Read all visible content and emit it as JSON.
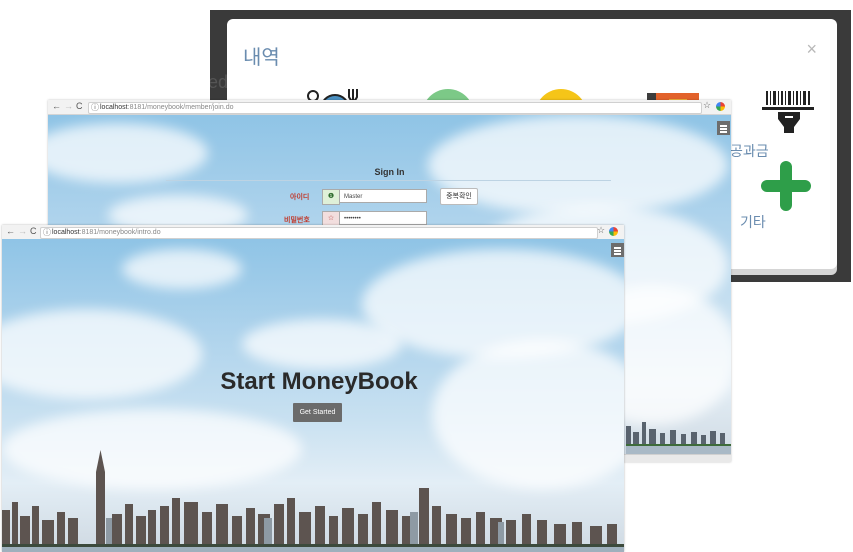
{
  "modal": {
    "background_text": "edi",
    "title": "내역",
    "close_icon": "×",
    "categories": [
      {
        "icon": "dining-icon",
        "label": ""
      },
      {
        "icon": "cash-icon",
        "label": ""
      },
      {
        "icon": "fuel-icon",
        "label": ""
      },
      {
        "icon": "book-icon",
        "label": ""
      },
      {
        "icon": "barcode-icon",
        "label": "공과금"
      },
      {
        "icon": "plus-icon",
        "label": "기타"
      }
    ],
    "colors": {
      "title": "#6a8caf",
      "plus": "#2e9e49"
    }
  },
  "join_page": {
    "browser": {
      "back": "←",
      "forward": "→",
      "reload": "C",
      "info": "ⓘ",
      "url_host": "localhost",
      "url_path": ":8181/moneybook/member/join.do",
      "star": "☆"
    },
    "title": "Sign In",
    "fields": [
      {
        "label": "아이디",
        "icon": "info-icon",
        "icon_glyph": "❶",
        "value": "Master",
        "label_color": "#c0392b",
        "icon_bg": "#dff0d8"
      },
      {
        "label": "비밀번호",
        "icon": "star-icon",
        "icon_glyph": "☆",
        "value": "••••••••",
        "label_color": "#c0392b",
        "icon_bg": "#f2dede"
      }
    ],
    "check_button": "중복확인"
  },
  "intro_page": {
    "browser": {
      "back": "←",
      "forward": "→",
      "reload": "C",
      "info": "ⓘ",
      "url_host": "localhost",
      "url_path": ":8181/moneybook/intro.do",
      "star": "☆"
    },
    "headline": "Start MoneyBook",
    "cta": "Get Started"
  }
}
